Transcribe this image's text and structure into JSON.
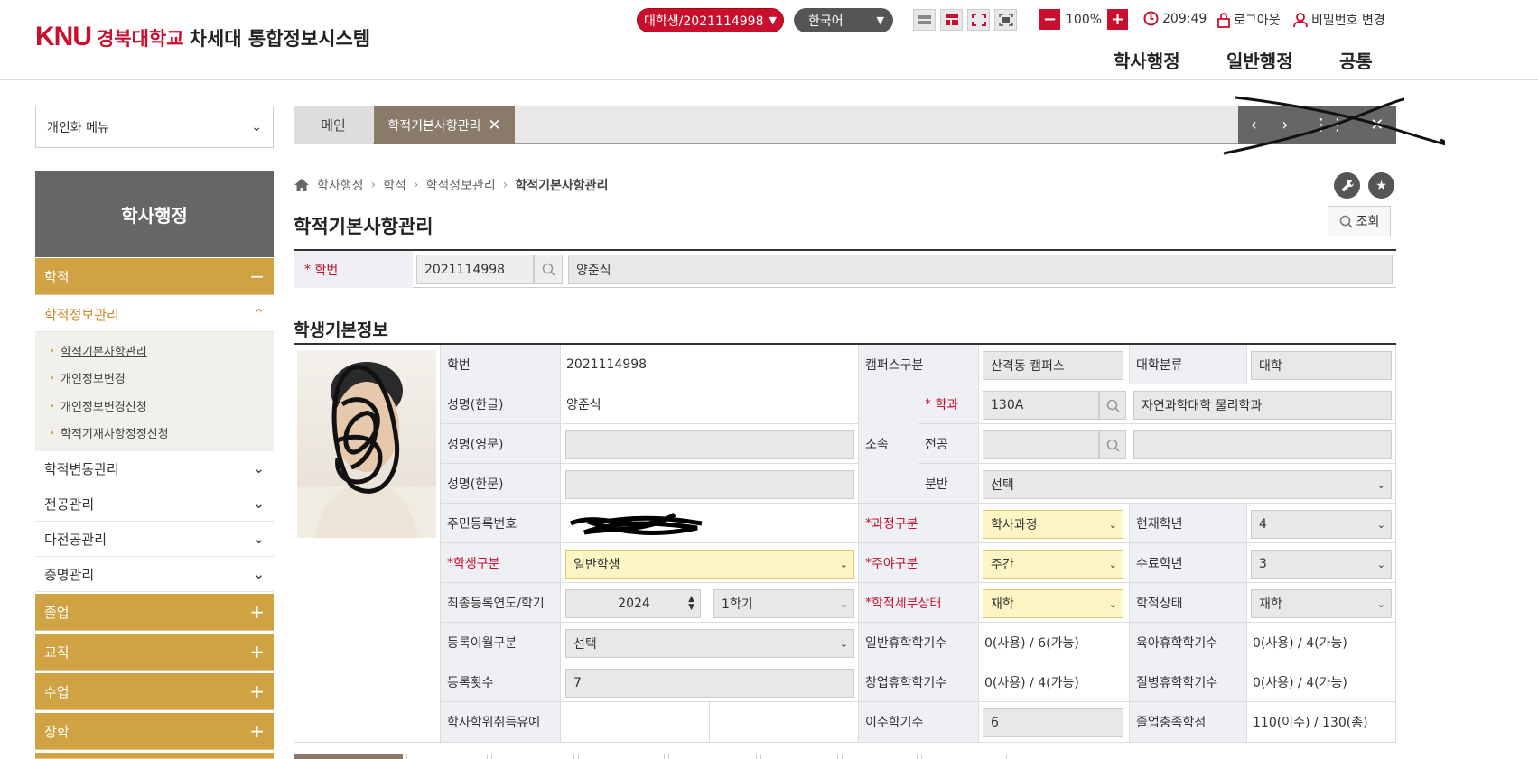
{
  "header": {
    "logo_knu": "KNU",
    "logo_univ": "경북대학교",
    "logo_system": "차세대 통합정보시스템",
    "user_select": "대학생/2021114998",
    "language": "한국어",
    "zoom_level": "100%",
    "timer": "209:49",
    "logout": "로그아웃",
    "password_change": "비밀번호 변경",
    "nav": [
      "학사행정",
      "일반행정",
      "공통"
    ]
  },
  "sidebar": {
    "personal_menu": "개인화 메뉴",
    "title": "학사행정",
    "items": [
      {
        "label": "학적",
        "icon": "minus"
      },
      {
        "label": "학적정보관리",
        "icon": "chevron-up"
      },
      {
        "label": "학적변동관리",
        "icon": "chevron-down"
      },
      {
        "label": "전공관리",
        "icon": "chevron-down"
      },
      {
        "label": "다전공관리",
        "icon": "chevron-down"
      },
      {
        "label": "증명관리",
        "icon": "chevron-down"
      },
      {
        "label": "졸업",
        "icon": "plus"
      },
      {
        "label": "교직",
        "icon": "plus"
      },
      {
        "label": "수업",
        "icon": "plus"
      },
      {
        "label": "장학",
        "icon": "plus"
      }
    ],
    "subitems": [
      "학적기본사항관리",
      "개인정보변경",
      "개인정보변경신청",
      "학적기재사항정정신청"
    ]
  },
  "tabs": {
    "main": "메인",
    "active": "학적기본사항관리"
  },
  "breadcrumb": [
    "학사행정",
    "학적",
    "학적정보관리",
    "학적기본사항관리"
  ],
  "page_title": "학적기본사항관리",
  "query_button": "조회",
  "search": {
    "label": "학번",
    "student_id": "2021114998",
    "name": "양준식"
  },
  "section_title": "학생기본정보",
  "info": {
    "labels": {
      "student_id": "학번",
      "name_kr": "성명(한글)",
      "name_en": "성명(영문)",
      "name_hanja": "성명(한문)",
      "resident_no": "주민등록번호",
      "student_type": "학생구분",
      "last_reg": "최종등록연도/학기",
      "overmonth": "등록이월구분",
      "reg_count": "등록횟수",
      "degree_defer": "학사학위취득유예",
      "campus": "캠퍼스구분",
      "affiliation": "소속",
      "dept": "학과",
      "major": "전공",
      "class": "분반",
      "course": "과정구분",
      "daynight": "주야구분",
      "detail_status": "학적세부상태",
      "general_leave": "일반휴학학기수",
      "startup_leave": "창업휴학학기수",
      "completed_sem": "이수학기수",
      "univ_class": "대학분류",
      "cur_grade": "현재학년",
      "finish_grade": "수료학년",
      "status": "학적상태",
      "parental_leave": "육아휴학학기수",
      "sick_leave": "질병휴학학기수",
      "grad_credits": "졸업충족학점"
    },
    "values": {
      "student_id": "2021114998",
      "name_kr": "양준식",
      "name_en": "",
      "name_hanja": "",
      "student_type": "일반학생",
      "last_year": "2024",
      "last_sem": "1학기",
      "overmonth": "선택",
      "reg_count": "7",
      "campus": "산격동 캠퍼스",
      "dept_code": "130A",
      "dept_name": "자연과학대학 물리학과",
      "class": "선택",
      "course": "학사과정",
      "daynight": "주간",
      "detail_status": "재학",
      "general_leave": "0(사용) / 6(가능)",
      "startup_leave": "0(사용) / 4(가능)",
      "completed_sem": "6",
      "univ_class": "대학",
      "cur_grade": "4",
      "finish_grade": "3",
      "status": "재학",
      "parental_leave": "0(사용) / 4(가능)",
      "sick_leave": "0(사용) / 4(가능)",
      "grad_credits": "110(이수) / 130(총)"
    }
  },
  "colors": {
    "brand_red": "#c8102e",
    "gold": "#cfa244",
    "required_field": "#fdf5c4"
  }
}
